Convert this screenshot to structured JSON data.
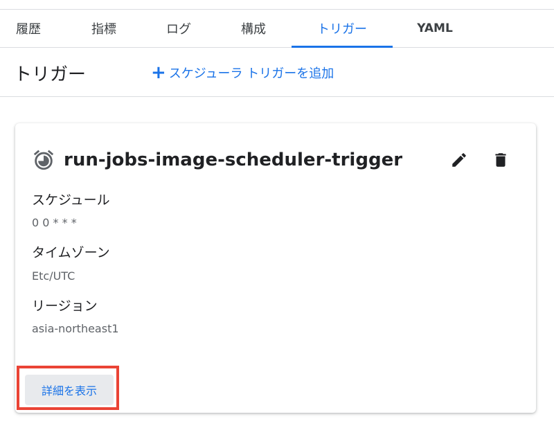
{
  "tabs": [
    {
      "label": "履歴"
    },
    {
      "label": "指標"
    },
    {
      "label": "ログ"
    },
    {
      "label": "構成"
    },
    {
      "label": "トリガー",
      "active": true
    },
    {
      "label": "YAML"
    }
  ],
  "header": {
    "title": "トリガー",
    "add_trigger_label": "スケジューラ トリガーを追加"
  },
  "card": {
    "trigger_name": "run-jobs-image-scheduler-trigger",
    "icons": [
      "alarm-icon",
      "edit-icon",
      "delete-icon"
    ],
    "fields": [
      {
        "label": "スケジュール",
        "value": "0 0 * * *"
      },
      {
        "label": "タイムゾーン",
        "value": "Etc/UTC"
      },
      {
        "label": "リージョン",
        "value": "asia-northeast1"
      }
    ],
    "details_button_label": "詳細を表示"
  },
  "colors": {
    "accent": "#1a73e8",
    "highlight": "#ea4335"
  }
}
